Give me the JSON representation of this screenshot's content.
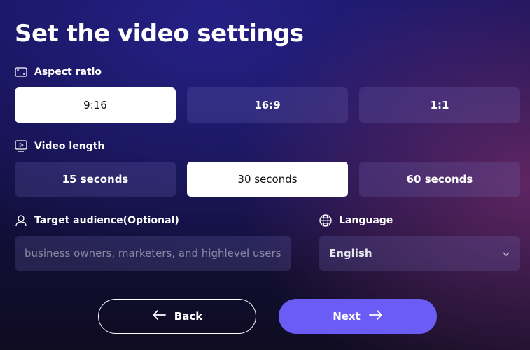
{
  "page": {
    "title": "Set the video settings"
  },
  "aspect_ratio": {
    "label": "Aspect ratio",
    "icon": "aspect-ratio-icon",
    "options": [
      "9:16",
      "16:9",
      "1:1"
    ],
    "selected": "9:16"
  },
  "video_length": {
    "label": "Video length",
    "icon": "video-monitor-icon",
    "options": [
      "15 seconds",
      "30 seconds",
      "60 seconds"
    ],
    "selected": "30 seconds"
  },
  "target_audience": {
    "label": "Target audience(Optional)",
    "icon": "user-icon",
    "placeholder": "business owners, marketers, and highlevel users",
    "value": ""
  },
  "language": {
    "label": "Language",
    "icon": "globe-icon",
    "value": "English"
  },
  "buttons": {
    "back": "Back",
    "next": "Next"
  },
  "colors": {
    "accent": "#6b5cf6",
    "selected_bg": "#ffffff"
  }
}
